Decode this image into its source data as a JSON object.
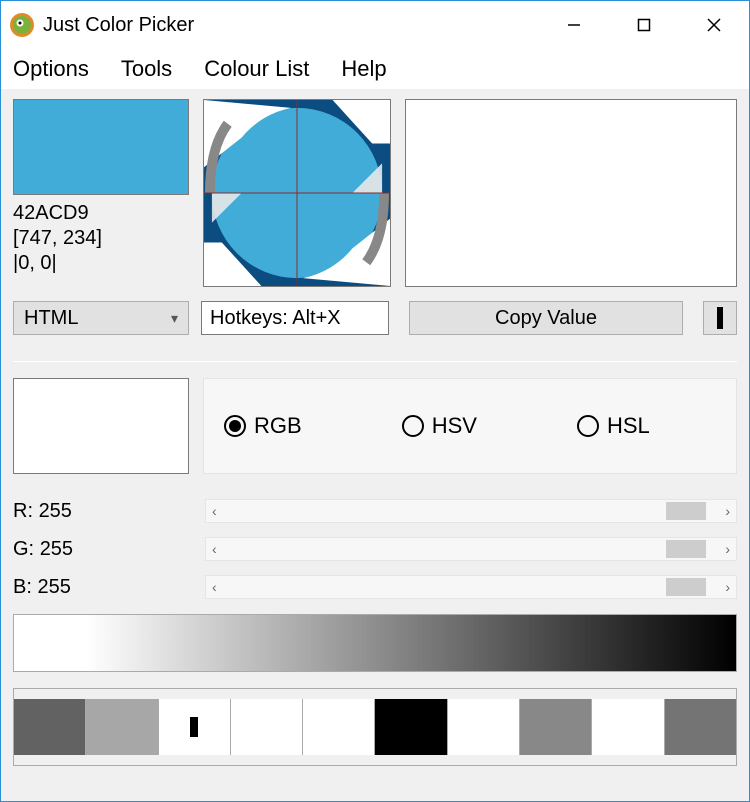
{
  "window": {
    "title": "Just Color Picker"
  },
  "menu": {
    "options": "Options",
    "tools": "Tools",
    "colourlist": "Colour List",
    "help": "Help"
  },
  "picked": {
    "color": "#42ACD9",
    "hex": "42ACD9",
    "coords": "[747, 234]",
    "delta": "|0, 0|"
  },
  "format": {
    "selected": "HTML"
  },
  "hotkey": {
    "text": "Hotkeys: Alt+X"
  },
  "copy": {
    "label": "Copy Value"
  },
  "mode": {
    "rgb": "RGB",
    "hsv": "HSV",
    "hsl": "HSL",
    "selected": "rgb"
  },
  "channels": {
    "r_label": "R:",
    "g_label": "G:",
    "b_label": "B:",
    "r": "255",
    "g": "255",
    "b": "255"
  },
  "palette": {
    "cells": [
      "#626262",
      "#a7a7a7",
      "#ffffff",
      "#ffffff",
      "#ffffff",
      "#000000",
      "#ffffff",
      "#888888",
      "#ffffff",
      "#747474"
    ],
    "marker_index": 2
  }
}
